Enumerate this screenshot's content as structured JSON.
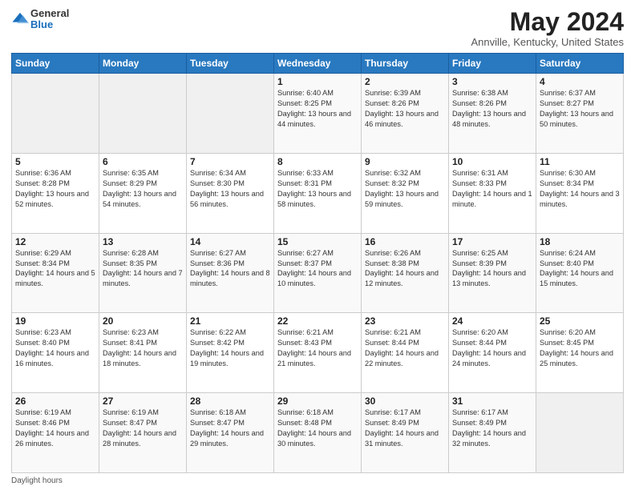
{
  "header": {
    "logo_general": "General",
    "logo_blue": "Blue",
    "title": "May 2024",
    "subtitle": "Annville, Kentucky, United States"
  },
  "footer": {
    "daylight_label": "Daylight hours"
  },
  "columns": [
    "Sunday",
    "Monday",
    "Tuesday",
    "Wednesday",
    "Thursday",
    "Friday",
    "Saturday"
  ],
  "weeks": [
    [
      {
        "day": "",
        "sunrise": "",
        "sunset": "",
        "daylight": ""
      },
      {
        "day": "",
        "sunrise": "",
        "sunset": "",
        "daylight": ""
      },
      {
        "day": "",
        "sunrise": "",
        "sunset": "",
        "daylight": ""
      },
      {
        "day": "1",
        "sunrise": "6:40 AM",
        "sunset": "8:25 PM",
        "daylight": "13 hours and 44 minutes."
      },
      {
        "day": "2",
        "sunrise": "6:39 AM",
        "sunset": "8:26 PM",
        "daylight": "13 hours and 46 minutes."
      },
      {
        "day": "3",
        "sunrise": "6:38 AM",
        "sunset": "8:26 PM",
        "daylight": "13 hours and 48 minutes."
      },
      {
        "day": "4",
        "sunrise": "6:37 AM",
        "sunset": "8:27 PM",
        "daylight": "13 hours and 50 minutes."
      }
    ],
    [
      {
        "day": "5",
        "sunrise": "6:36 AM",
        "sunset": "8:28 PM",
        "daylight": "13 hours and 52 minutes."
      },
      {
        "day": "6",
        "sunrise": "6:35 AM",
        "sunset": "8:29 PM",
        "daylight": "13 hours and 54 minutes."
      },
      {
        "day": "7",
        "sunrise": "6:34 AM",
        "sunset": "8:30 PM",
        "daylight": "13 hours and 56 minutes."
      },
      {
        "day": "8",
        "sunrise": "6:33 AM",
        "sunset": "8:31 PM",
        "daylight": "13 hours and 58 minutes."
      },
      {
        "day": "9",
        "sunrise": "6:32 AM",
        "sunset": "8:32 PM",
        "daylight": "13 hours and 59 minutes."
      },
      {
        "day": "10",
        "sunrise": "6:31 AM",
        "sunset": "8:33 PM",
        "daylight": "14 hours and 1 minute."
      },
      {
        "day": "11",
        "sunrise": "6:30 AM",
        "sunset": "8:34 PM",
        "daylight": "14 hours and 3 minutes."
      }
    ],
    [
      {
        "day": "12",
        "sunrise": "6:29 AM",
        "sunset": "8:34 PM",
        "daylight": "14 hours and 5 minutes."
      },
      {
        "day": "13",
        "sunrise": "6:28 AM",
        "sunset": "8:35 PM",
        "daylight": "14 hours and 7 minutes."
      },
      {
        "day": "14",
        "sunrise": "6:27 AM",
        "sunset": "8:36 PM",
        "daylight": "14 hours and 8 minutes."
      },
      {
        "day": "15",
        "sunrise": "6:27 AM",
        "sunset": "8:37 PM",
        "daylight": "14 hours and 10 minutes."
      },
      {
        "day": "16",
        "sunrise": "6:26 AM",
        "sunset": "8:38 PM",
        "daylight": "14 hours and 12 minutes."
      },
      {
        "day": "17",
        "sunrise": "6:25 AM",
        "sunset": "8:39 PM",
        "daylight": "14 hours and 13 minutes."
      },
      {
        "day": "18",
        "sunrise": "6:24 AM",
        "sunset": "8:40 PM",
        "daylight": "14 hours and 15 minutes."
      }
    ],
    [
      {
        "day": "19",
        "sunrise": "6:23 AM",
        "sunset": "8:40 PM",
        "daylight": "14 hours and 16 minutes."
      },
      {
        "day": "20",
        "sunrise": "6:23 AM",
        "sunset": "8:41 PM",
        "daylight": "14 hours and 18 minutes."
      },
      {
        "day": "21",
        "sunrise": "6:22 AM",
        "sunset": "8:42 PM",
        "daylight": "14 hours and 19 minutes."
      },
      {
        "day": "22",
        "sunrise": "6:21 AM",
        "sunset": "8:43 PM",
        "daylight": "14 hours and 21 minutes."
      },
      {
        "day": "23",
        "sunrise": "6:21 AM",
        "sunset": "8:44 PM",
        "daylight": "14 hours and 22 minutes."
      },
      {
        "day": "24",
        "sunrise": "6:20 AM",
        "sunset": "8:44 PM",
        "daylight": "14 hours and 24 minutes."
      },
      {
        "day": "25",
        "sunrise": "6:20 AM",
        "sunset": "8:45 PM",
        "daylight": "14 hours and 25 minutes."
      }
    ],
    [
      {
        "day": "26",
        "sunrise": "6:19 AM",
        "sunset": "8:46 PM",
        "daylight": "14 hours and 26 minutes."
      },
      {
        "day": "27",
        "sunrise": "6:19 AM",
        "sunset": "8:47 PM",
        "daylight": "14 hours and 28 minutes."
      },
      {
        "day": "28",
        "sunrise": "6:18 AM",
        "sunset": "8:47 PM",
        "daylight": "14 hours and 29 minutes."
      },
      {
        "day": "29",
        "sunrise": "6:18 AM",
        "sunset": "8:48 PM",
        "daylight": "14 hours and 30 minutes."
      },
      {
        "day": "30",
        "sunrise": "6:17 AM",
        "sunset": "8:49 PM",
        "daylight": "14 hours and 31 minutes."
      },
      {
        "day": "31",
        "sunrise": "6:17 AM",
        "sunset": "8:49 PM",
        "daylight": "14 hours and 32 minutes."
      },
      {
        "day": "",
        "sunrise": "",
        "sunset": "",
        "daylight": ""
      }
    ]
  ]
}
